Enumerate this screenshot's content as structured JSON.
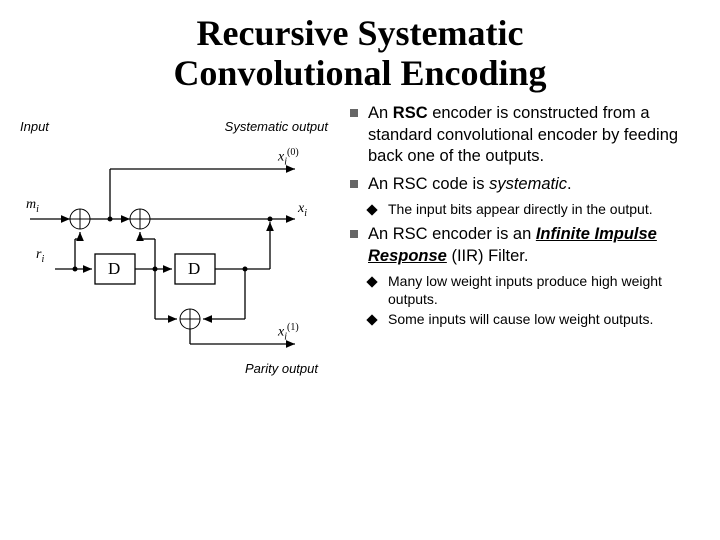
{
  "title_line1": "Recursive Systematic",
  "title_line2": "Convolutional Encoding",
  "labels": {
    "input": "Input",
    "systematic_output": "Systematic output",
    "parity_output": "Parity output",
    "delay": "D"
  },
  "math": {
    "m_i": "m",
    "m_i_sub": "i",
    "r_i": "r",
    "r_i_sub": "i",
    "x0": "x",
    "x0_sub": "i",
    "x0_sup": "(0)",
    "xi": "x",
    "xi_sub": "i",
    "x1": "x",
    "x1_sub": "i",
    "x1_sup": "(1)"
  },
  "bullets": {
    "b1_a": "An ",
    "b1_b": "RSC",
    "b1_c": " encoder is constructed from a standard convolutional encoder by feeding back one of the outputs.",
    "b2_a": "An RSC code is ",
    "b2_b": "systematic",
    "b2_c": ".",
    "b2_s1": "The input bits appear directly in the output.",
    "b3_a": "An RSC encoder is an ",
    "b3_b": "Infinite Impulse Response",
    "b3_c": " (IIR) Filter.",
    "b3_s1": "Many low weight inputs produce high weight outputs.",
    "b3_s2": "Some inputs will cause low weight outputs."
  }
}
